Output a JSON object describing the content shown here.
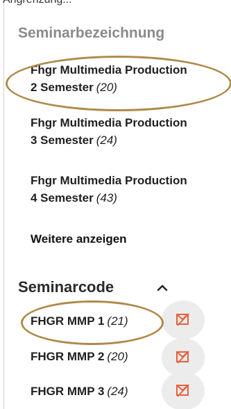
{
  "top_fragment": "Angrenzung...",
  "seminar_title_section": {
    "title": "Seminarbezeichnung",
    "items": [
      {
        "name_line1": "Fhgr Multimedia Production",
        "name_line2": "2 Semester",
        "count": "(20)"
      },
      {
        "name_line1": "Fhgr Multimedia Production",
        "name_line2": "3 Semester",
        "count": "(24)"
      },
      {
        "name_line1": "Fhgr Multimedia Production",
        "name_line2": "4 Semester",
        "count": "(43)"
      }
    ],
    "show_more": "Weitere anzeigen"
  },
  "seminar_code_section": {
    "title": "Seminarcode",
    "items": [
      {
        "name": "FHGR MMP 1",
        "count": "(21)"
      },
      {
        "name": "FHGR MMP 2",
        "count": "(20)"
      },
      {
        "name": "FHGR MMP 3",
        "count": "(24)"
      }
    ]
  },
  "colors": {
    "highlight": "#b08a4a",
    "exclude_icon": "#e8603c"
  },
  "icons": {
    "collapse": "chevron-up-icon",
    "exclude": "exclude-filter-icon"
  }
}
